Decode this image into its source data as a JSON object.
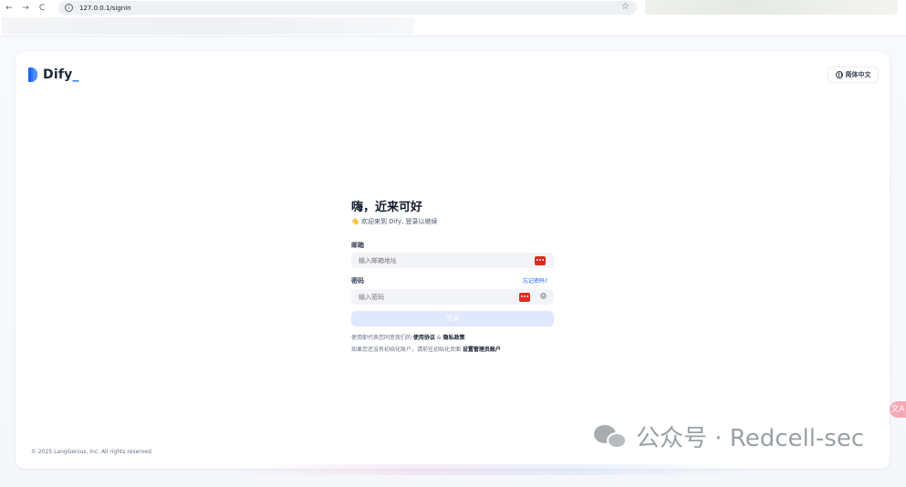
{
  "browser": {
    "back_glyph": "←",
    "forward_glyph": "→",
    "reload_glyph": "C",
    "info_glyph": "i",
    "url": "127.0.0.1/signin",
    "star_glyph": "☆"
  },
  "header": {
    "logo_text": "Dify",
    "logo_dot": "_",
    "language_label": "简体中文"
  },
  "form": {
    "title": "嗨，近来可好",
    "subtitle": "👋 欢迎来到 Dify, 登录以继续",
    "email_label": "邮箱",
    "email_placeholder": "输入邮箱地址",
    "password_label": "密码",
    "forgot_password": "忘记密码?",
    "password_placeholder": "输入密码",
    "pw_manager_badge": "•••",
    "eye_glyph": "😑",
    "submit_label": "登录",
    "terms_prefix": "使用即代表您同意我们的 ",
    "terms_link": "使用协议",
    "terms_and": " & ",
    "privacy_link": "隐私政策",
    "setup_prefix": "如果您还没有初始化账户，请前往初始化页面 ",
    "setup_link": "设置管理员账户"
  },
  "footer": {
    "copyright": "© 2025 LangGenius, Inc. All rights reserved."
  },
  "watermark": {
    "text": "公众号 · Redcell-sec"
  },
  "side_widget": {
    "glyph": "文A"
  },
  "colors": {
    "accent": "#1c64f2",
    "badge_red": "#d92d20",
    "submit_disabled": "#dfe8fc"
  }
}
